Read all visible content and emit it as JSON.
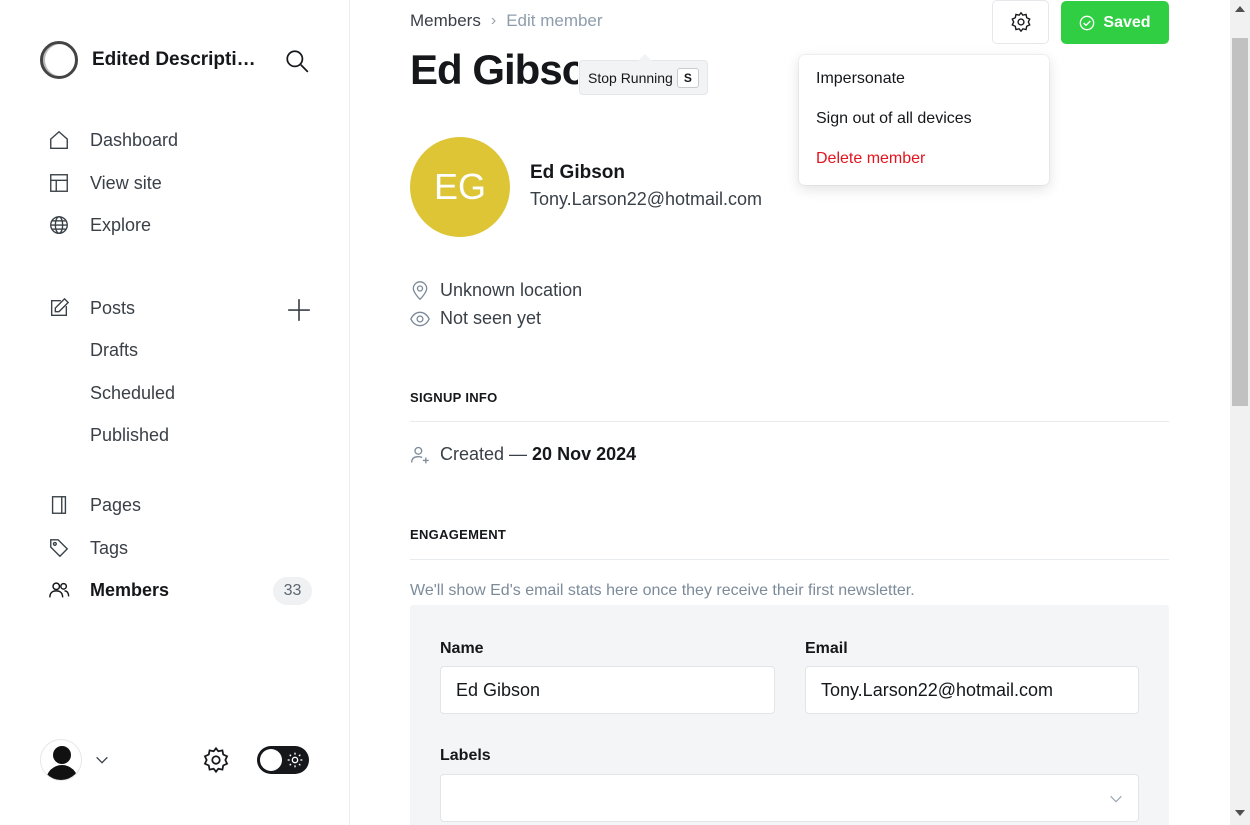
{
  "site": {
    "title": "Edited Description of Ghost"
  },
  "nav": {
    "dashboard": "Dashboard",
    "view_site": "View site",
    "explore": "Explore",
    "posts": "Posts",
    "drafts": "Drafts",
    "scheduled": "Scheduled",
    "published": "Published",
    "pages": "Pages",
    "tags": "Tags",
    "members": "Members",
    "members_count": "33"
  },
  "breadcrumb": {
    "parent": "Members",
    "current": "Edit member"
  },
  "page": {
    "title": "Ed Gibson"
  },
  "tooltip": {
    "label": "Stop Running",
    "shortcut": "S"
  },
  "actions": {
    "saved_label": "Saved"
  },
  "dropdown": {
    "items": [
      "Impersonate",
      "Sign out of all devices"
    ],
    "danger": "Delete member"
  },
  "member": {
    "initials": "EG",
    "name": "Ed Gibson",
    "email": "Tony.Larson22@hotmail.com",
    "location": "Unknown location",
    "seen": "Not seen yet",
    "avatar_color": "#ddc535"
  },
  "signup": {
    "heading": "SIGNUP INFO",
    "created_label": "Created —",
    "created_date": "20 Nov 2024"
  },
  "engagement": {
    "heading": "ENGAGEMENT",
    "note": "We'll show Ed's email stats here once they receive their first newsletter."
  },
  "form": {
    "name_label": "Name",
    "name_value": "Ed Gibson",
    "email_label": "Email",
    "email_value": "Tony.Larson22@hotmail.com",
    "labels_label": "Labels",
    "labels_value": ""
  },
  "colors": {
    "accent": "#30cf43",
    "danger": "#e2151f",
    "text": "#15171a"
  }
}
